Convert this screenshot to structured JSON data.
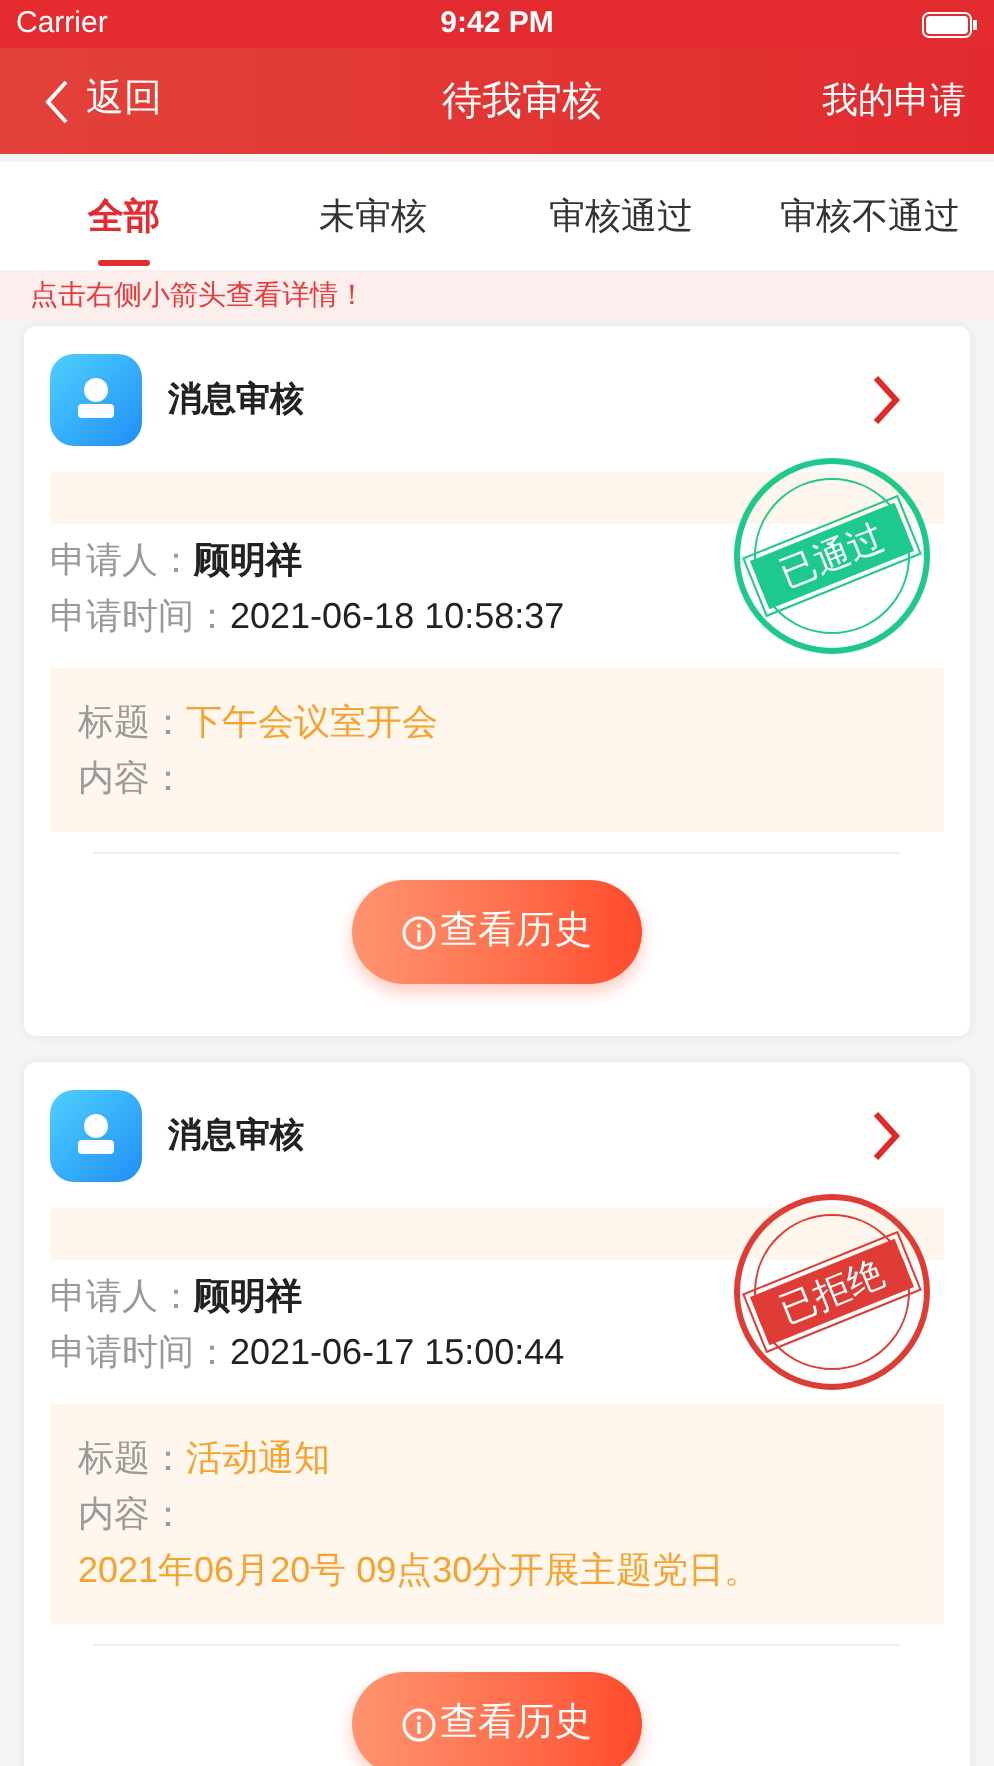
{
  "status_bar": {
    "carrier": "Carrier",
    "time": "9:42 PM"
  },
  "nav": {
    "back": "返回",
    "title": "待我审核",
    "action": "我的申请"
  },
  "tabs": [
    {
      "label": "全部",
      "selected": true
    },
    {
      "label": "未审核",
      "selected": false
    },
    {
      "label": "审核通过",
      "selected": false
    },
    {
      "label": "审核不通过",
      "selected": false
    }
  ],
  "hint": "点击右侧小箭头查看详情！",
  "cards": [
    {
      "title": "消息审核",
      "applicant_label": "申请人：",
      "applicant": "顾明祥",
      "time_label": "申请时间：",
      "time": "2021-06-18 10:58:37",
      "status": {
        "kind": "approved",
        "label": "已通过"
      },
      "subject_label": "标题：",
      "subject": "下午会议室开会",
      "content_label": "内容：",
      "button": "查看历史"
    },
    {
      "title": "消息审核",
      "applicant_label": "申请人：",
      "applicant": "顾明祥",
      "time_label": "申请时间：",
      "time": "2021-06-17 15:00:44",
      "status": {
        "kind": "rejected",
        "label": "已拒绝"
      },
      "subject_label": "标题：",
      "subject": "活动通知",
      "content_label": "内容：",
      "content": "2021年06月20号 09点30分开展主题党日。",
      "button": "查看历史"
    }
  ]
}
